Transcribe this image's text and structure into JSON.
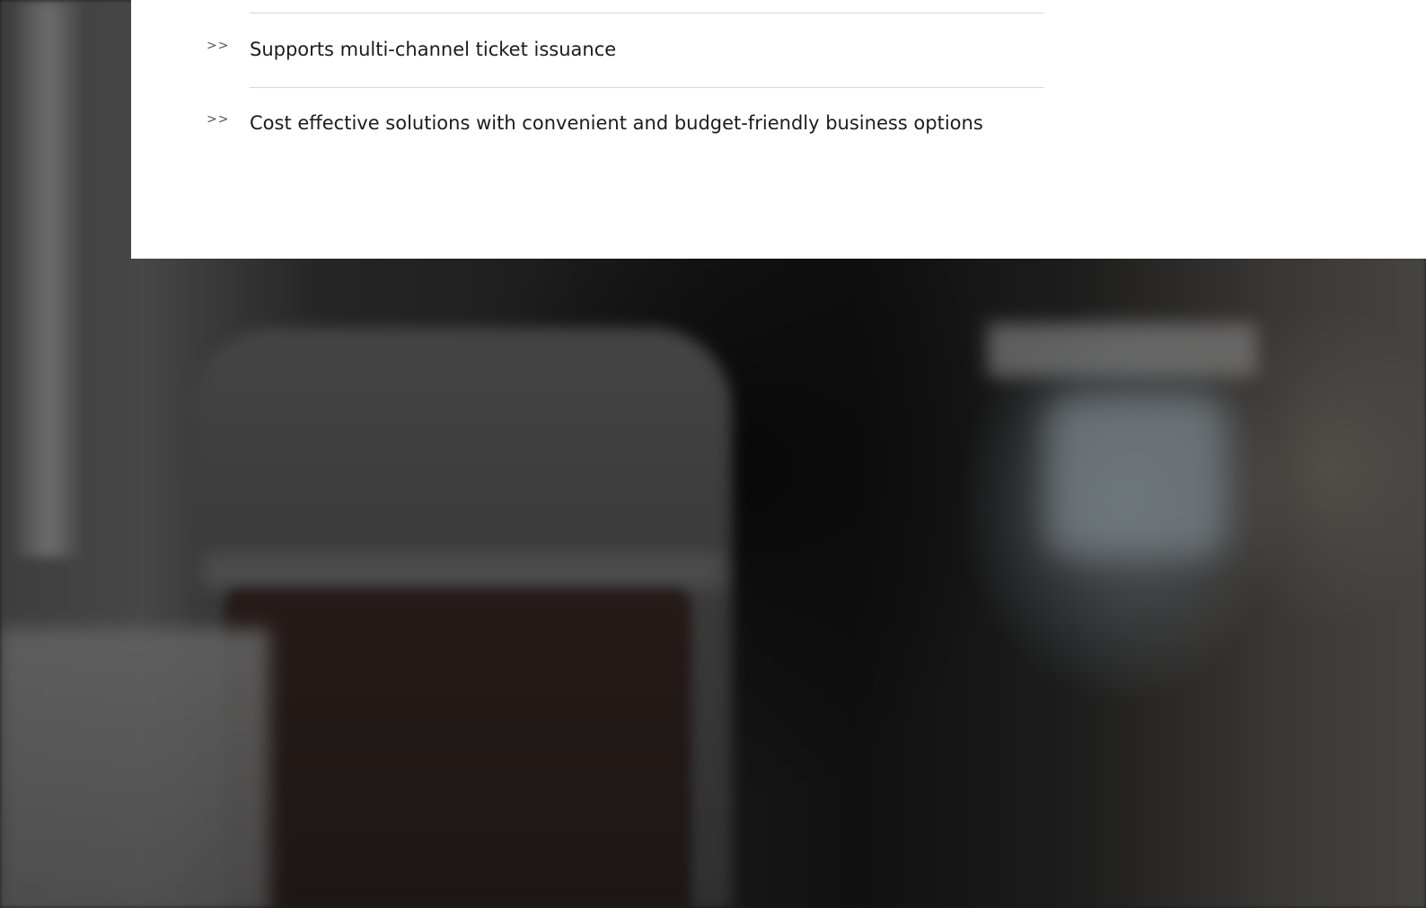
{
  "features": {
    "items": [
      {
        "icon": "double-chevron-right-icon",
        "marker": ">>",
        "text": "Supports multi-channel ticket issuance"
      },
      {
        "icon": "double-chevron-right-icon",
        "marker": ">>",
        "text": "Cost effective solutions with convenient and budget-friendly business options"
      }
    ]
  },
  "colors": {
    "panel_background": "#ffffff",
    "text": "#1c1c1c",
    "divider": "#d6d6d6",
    "marker": "#555555"
  }
}
